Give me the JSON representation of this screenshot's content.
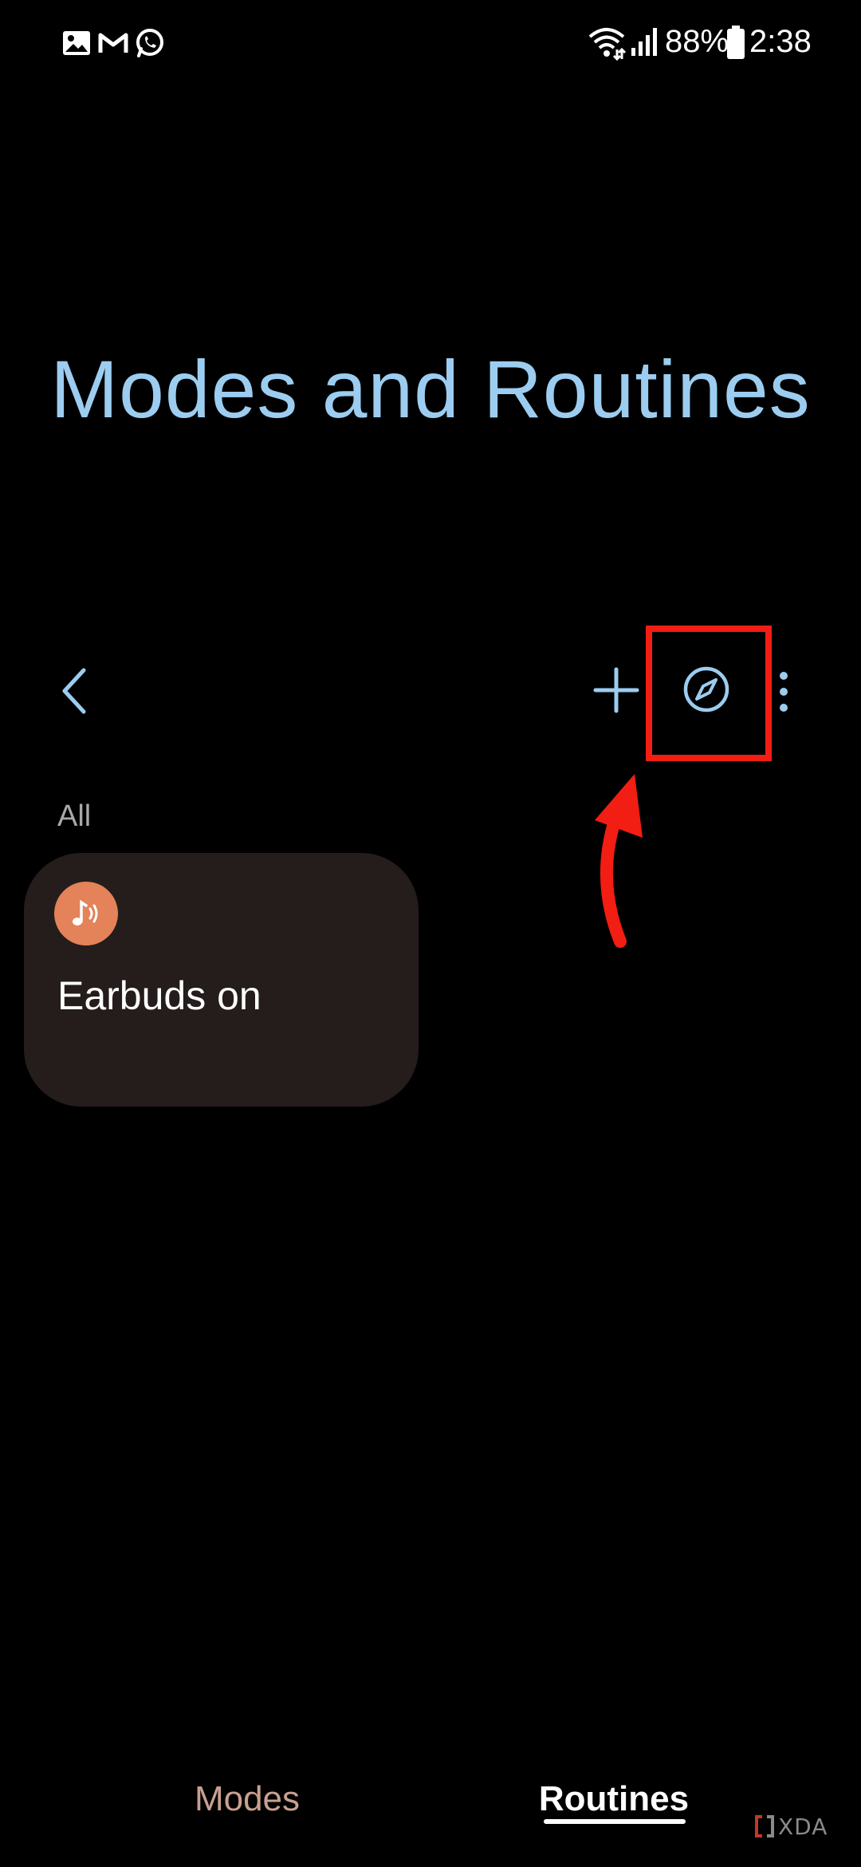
{
  "status_bar": {
    "notification_icons": [
      "gallery-icon",
      "gmail-icon",
      "whatsapp-icon"
    ],
    "system_icons": [
      "wifi-icon",
      "signal-icon",
      "battery-icon"
    ],
    "battery": "88%",
    "time": "2:38"
  },
  "header": {
    "title": "Modes and Routines"
  },
  "toolbar": {
    "back_icon": "chevron-left-icon",
    "add_icon": "plus-icon",
    "discover_icon": "compass-icon",
    "more_icon": "more-vertical-icon"
  },
  "routines": {
    "section_label": "All",
    "items": [
      {
        "name": "Earbuds on",
        "icon": "music-sound-icon",
        "icon_color": "#e4825a"
      }
    ]
  },
  "bottom_tabs": {
    "modes_label": "Modes",
    "routines_label": "Routines",
    "active": "Routines"
  },
  "annotation": {
    "highlight_color": "#f21d13"
  },
  "watermark": {
    "text": "XDA"
  },
  "colors": {
    "title": "#9ccdf0",
    "card_bg": "#241d1b",
    "background": "#000000"
  }
}
